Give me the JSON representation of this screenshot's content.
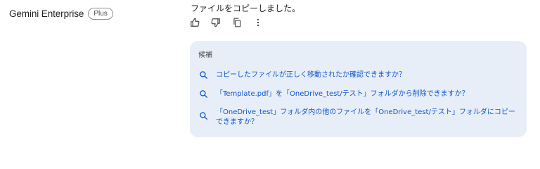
{
  "brand": {
    "name": "Gemini Enterprise",
    "plan_badge": "Plus"
  },
  "response": {
    "text": "ファイルをコピーしました。"
  },
  "actions": [
    {
      "icon": "thumbs-up-icon"
    },
    {
      "icon": "thumbs-down-icon"
    },
    {
      "icon": "copy-icon"
    },
    {
      "icon": "more-vert-icon"
    }
  ],
  "suggestions": {
    "title": "候補",
    "items": [
      {
        "icon": "search-icon",
        "text": "コピーしたファイルが正しく移動されたか確認できますか？"
      },
      {
        "icon": "search-icon",
        "text": "「Template.pdf」を「OneDrive_test/テスト」フォルダから削除できますか？"
      },
      {
        "icon": "search-icon",
        "text": "「OneDrive_test」フォルダ内の他のファイルを「OneDrive_test/テスト」フォルダにコピーできますか？"
      }
    ]
  },
  "colors": {
    "panel_bg": "#e8eef7",
    "link": "#0b57d0"
  }
}
